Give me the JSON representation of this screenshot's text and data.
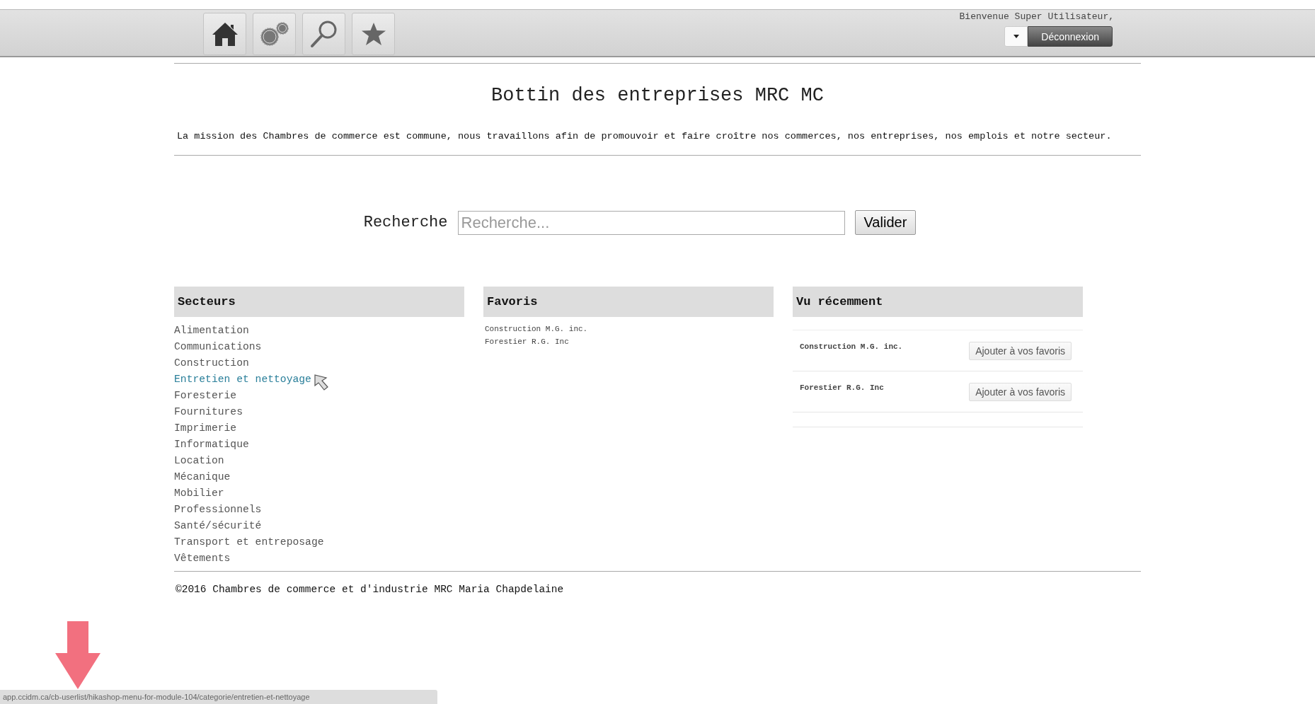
{
  "header": {
    "greeting": "Bienvenue Super Utilisateur,",
    "logout_button": "Déconnexion"
  },
  "page": {
    "title": "Bottin des entreprises MRC MC",
    "mission": "La mission des Chambres de commerce est commune, nous travaillons afin de promouvoir et faire croître nos commerces, nos entreprises, nos emplois et notre secteur."
  },
  "search": {
    "label": "Recherche",
    "placeholder": "Recherche...",
    "button": "Valider"
  },
  "sectors": {
    "title": "Secteurs",
    "items": [
      {
        "label": "Alimentation",
        "hovered": false
      },
      {
        "label": "Communications",
        "hovered": false
      },
      {
        "label": "Construction",
        "hovered": false
      },
      {
        "label": "Entretien et nettoyage",
        "hovered": true
      },
      {
        "label": "Foresterie",
        "hovered": false
      },
      {
        "label": "Fournitures",
        "hovered": false
      },
      {
        "label": "Imprimerie",
        "hovered": false
      },
      {
        "label": "Informatique",
        "hovered": false
      },
      {
        "label": "Location",
        "hovered": false
      },
      {
        "label": "Mécanique",
        "hovered": false
      },
      {
        "label": "Mobilier",
        "hovered": false
      },
      {
        "label": "Professionnels",
        "hovered": false
      },
      {
        "label": "Santé/sécurité",
        "hovered": false
      },
      {
        "label": "Transport et entreposage",
        "hovered": false
      },
      {
        "label": "Vêtements",
        "hovered": false
      }
    ]
  },
  "favorites": {
    "title": "Favoris",
    "items": [
      "Construction M.G. inc.",
      "Forestier R.G. Inc"
    ]
  },
  "recent": {
    "title": "Vu récemment",
    "items": [
      {
        "name": "Construction M.G. inc.",
        "button": "Ajouter à vos favoris"
      },
      {
        "name": "Forestier R.G. Inc",
        "button": "Ajouter à vos favoris"
      }
    ]
  },
  "footer": "©2016 Chambres de commerce et d'industrie MRC Maria Chapdelaine",
  "status_bar": {
    "url": "app.ccidm.ca/cb-userlist/hikashop-menu-for-module-104/categorie/entretien-et-nettoyage"
  }
}
